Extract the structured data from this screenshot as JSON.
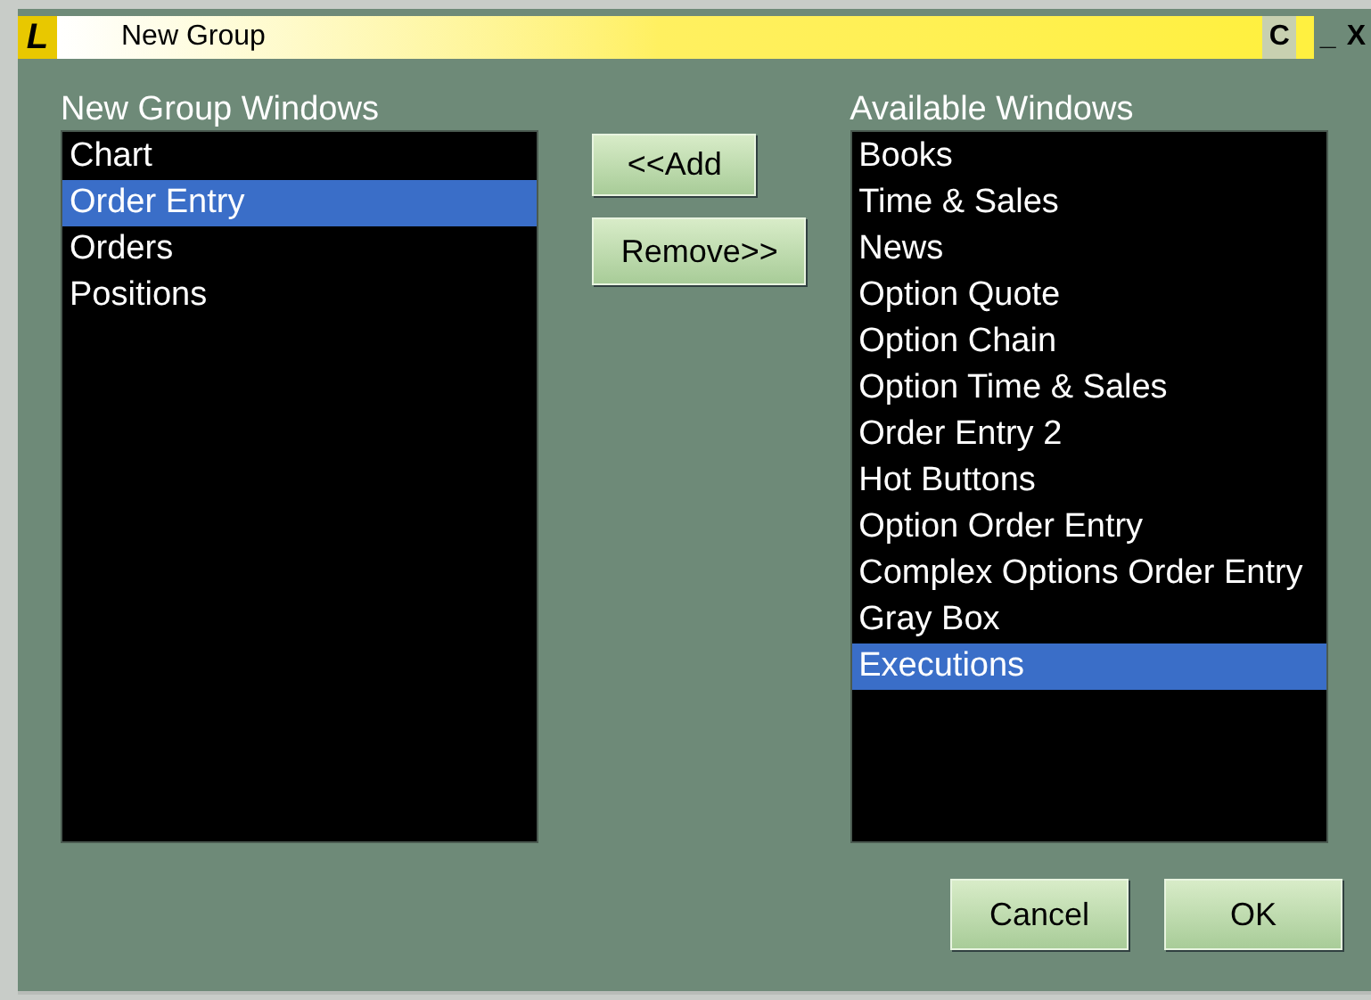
{
  "window": {
    "title": "New Group",
    "logo": "L",
    "title_buttons": [
      "C",
      "_",
      "X"
    ]
  },
  "left_list": {
    "label": "New Group Windows",
    "items": [
      {
        "text": "Chart",
        "selected": false
      },
      {
        "text": "Order Entry",
        "selected": true
      },
      {
        "text": "Orders",
        "selected": false
      },
      {
        "text": "Positions",
        "selected": false
      }
    ]
  },
  "middle_buttons": [
    "<<Add",
    "Remove>>"
  ],
  "right_list": {
    "label": "Available Windows",
    "items": [
      {
        "text": "Books",
        "selected": false
      },
      {
        "text": "Time & Sales",
        "selected": false
      },
      {
        "text": "News",
        "selected": false
      },
      {
        "text": "Option Quote",
        "selected": false
      },
      {
        "text": "Option Chain",
        "selected": false
      },
      {
        "text": "Option Time & Sales",
        "selected": false
      },
      {
        "text": "Order Entry 2",
        "selected": false
      },
      {
        "text": "Hot Buttons",
        "selected": false
      },
      {
        "text": "Option Order Entry",
        "selected": false
      },
      {
        "text": "Complex Options Order Entry",
        "selected": false
      },
      {
        "text": "Gray Box",
        "selected": false
      },
      {
        "text": "Executions",
        "selected": true
      }
    ]
  },
  "buttons": [
    "Cancel",
    "OK"
  ]
}
